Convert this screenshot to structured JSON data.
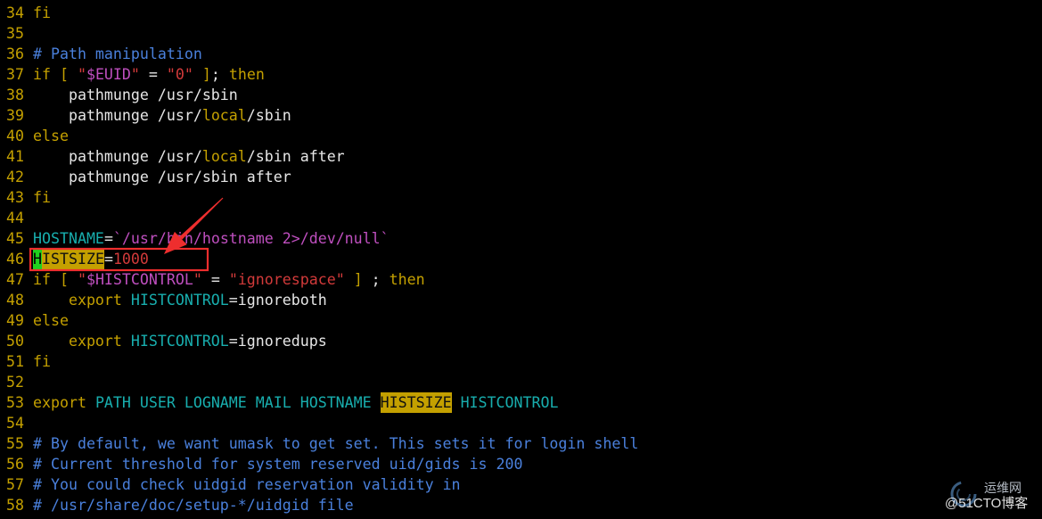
{
  "colors": {
    "background": "#000000",
    "line_number": "#c4a000",
    "annotation": "#ee2e2e",
    "watermark_logo": "#6aaaea"
  },
  "editor": {
    "lines": [
      {
        "num": "34",
        "tokens": [
          {
            "text": "fi",
            "fg": "#c4a000"
          }
        ]
      },
      {
        "num": "35",
        "tokens": []
      },
      {
        "num": "36",
        "tokens": [
          {
            "text": "# Path manipulation",
            "fg": "#4a80dc"
          }
        ]
      },
      {
        "num": "37",
        "tokens": [
          {
            "text": "if [ ",
            "fg": "#c4a000"
          },
          {
            "text": "\"",
            "fg": "#d23a3a"
          },
          {
            "text": "$EUID",
            "fg": "#bf4fbf"
          },
          {
            "text": "\"",
            "fg": "#d23a3a"
          },
          {
            "text": " = ",
            "fg": "#e6e6e6"
          },
          {
            "text": "\"0\"",
            "fg": "#d23a3a"
          },
          {
            "text": " ]",
            "fg": "#c4a000"
          },
          {
            "text": "; ",
            "fg": "#e6e6e6"
          },
          {
            "text": "then",
            "fg": "#c4a000"
          }
        ]
      },
      {
        "num": "38",
        "tokens": [
          {
            "text": "    pathmunge /usr/sbin",
            "fg": "#e6e6e6"
          }
        ]
      },
      {
        "num": "39",
        "tokens": [
          {
            "text": "    pathmunge /usr/",
            "fg": "#e6e6e6"
          },
          {
            "text": "local",
            "fg": "#c4a000"
          },
          {
            "text": "/sbin",
            "fg": "#e6e6e6"
          }
        ]
      },
      {
        "num": "40",
        "tokens": [
          {
            "text": "else",
            "fg": "#c4a000"
          }
        ]
      },
      {
        "num": "41",
        "tokens": [
          {
            "text": "    pathmunge /usr/",
            "fg": "#e6e6e6"
          },
          {
            "text": "local",
            "fg": "#c4a000"
          },
          {
            "text": "/sbin after",
            "fg": "#e6e6e6"
          }
        ]
      },
      {
        "num": "42",
        "tokens": [
          {
            "text": "    pathmunge /usr/sbin after",
            "fg": "#e6e6e6"
          }
        ]
      },
      {
        "num": "43",
        "tokens": [
          {
            "text": "fi",
            "fg": "#c4a000"
          }
        ]
      },
      {
        "num": "44",
        "tokens": []
      },
      {
        "num": "45",
        "tokens": [
          {
            "text": "HOSTNAME",
            "fg": "#18aeae"
          },
          {
            "text": "=",
            "fg": "#e6e6e6"
          },
          {
            "text": "`/usr/bin/hostname 2>/dev/null`",
            "fg": "#bf4fbf"
          }
        ]
      },
      {
        "num": "46",
        "tokens": [
          {
            "text": "H",
            "fg": "#000000",
            "bg": "#1fd11f",
            "cursor": true
          },
          {
            "text": "ISTSIZE",
            "fg": "#101010",
            "bg": "#c4a000",
            "match": true
          },
          {
            "text": "=",
            "fg": "#e6e6e6"
          },
          {
            "text": "1000",
            "fg": "#d23a3a"
          }
        ]
      },
      {
        "num": "47",
        "tokens": [
          {
            "text": "if [ ",
            "fg": "#c4a000"
          },
          {
            "text": "\"",
            "fg": "#d23a3a"
          },
          {
            "text": "$HISTCONTROL",
            "fg": "#bf4fbf"
          },
          {
            "text": "\"",
            "fg": "#d23a3a"
          },
          {
            "text": " = ",
            "fg": "#e6e6e6"
          },
          {
            "text": "\"ignorespace\"",
            "fg": "#d23a3a"
          },
          {
            "text": " ]",
            "fg": "#c4a000"
          },
          {
            "text": " ; ",
            "fg": "#e6e6e6"
          },
          {
            "text": "then",
            "fg": "#c4a000"
          }
        ]
      },
      {
        "num": "48",
        "tokens": [
          {
            "text": "    export",
            "fg": "#c4a000"
          },
          {
            "text": " HISTCONTROL",
            "fg": "#18aeae"
          },
          {
            "text": "=ignoreboth",
            "fg": "#e6e6e6"
          }
        ]
      },
      {
        "num": "49",
        "tokens": [
          {
            "text": "else",
            "fg": "#c4a000"
          }
        ]
      },
      {
        "num": "50",
        "tokens": [
          {
            "text": "    export",
            "fg": "#c4a000"
          },
          {
            "text": " HISTCONTROL",
            "fg": "#18aeae"
          },
          {
            "text": "=ignoredups",
            "fg": "#e6e6e6"
          }
        ]
      },
      {
        "num": "51",
        "tokens": [
          {
            "text": "fi",
            "fg": "#c4a000"
          }
        ]
      },
      {
        "num": "52",
        "tokens": []
      },
      {
        "num": "53",
        "tokens": [
          {
            "text": "export",
            "fg": "#c4a000"
          },
          {
            "text": " PATH USER LOGNAME MAIL HOSTNAME ",
            "fg": "#18aeae"
          },
          {
            "text": "HISTSIZE",
            "fg": "#101010",
            "bg": "#c4a000",
            "match": true
          },
          {
            "text": " HISTCONTROL",
            "fg": "#18aeae"
          }
        ]
      },
      {
        "num": "54",
        "tokens": []
      },
      {
        "num": "55",
        "tokens": [
          {
            "text": "# By default, we want umask to get set. This sets it for login shell",
            "fg": "#4a80dc"
          }
        ]
      },
      {
        "num": "56",
        "tokens": [
          {
            "text": "# Current threshold for system reserved uid/gids is 200",
            "fg": "#4a80dc"
          }
        ]
      },
      {
        "num": "57",
        "tokens": [
          {
            "text": "# You could check uidgid reservation validity in",
            "fg": "#4a80dc"
          }
        ]
      },
      {
        "num": "58",
        "tokens": [
          {
            "text": "# /usr/share/doc/setup-*/uidgid file",
            "fg": "#4a80dc"
          }
        ]
      }
    ]
  },
  "watermark": {
    "site": "运维网",
    "brand": "@51CTO博客"
  }
}
